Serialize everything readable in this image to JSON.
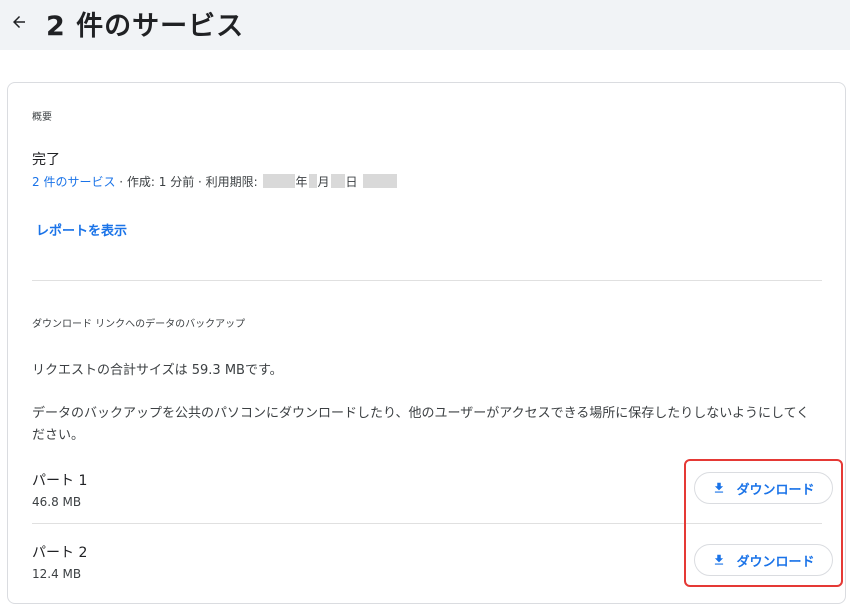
{
  "header": {
    "title": "2 件のサービス",
    "back_icon": "arrow-left-icon"
  },
  "summary": {
    "section_label": "概要",
    "status": "完了",
    "services_link": "2 件のサービス",
    "created_text": " · 作成: 1 分前 · 利用期限: ",
    "date_year": "年",
    "date_month": "月",
    "date_day": "日",
    "report_link": "レポートを表示"
  },
  "download_section": {
    "section_label": "ダウンロード リンクへのデータのバックアップ",
    "total_size_text": "リクエストの合計サイズは 59.3 MBです。",
    "warning_text": "データのバックアップを公共のパソコンにダウンロードしたり、他のユーザーがアクセスできる場所に保存したりしないようにしてください。",
    "parts": [
      {
        "name": "パート 1",
        "size": "46.8 MB",
        "button_label": "ダウンロード",
        "icon": "download-icon"
      },
      {
        "name": "パート 2",
        "size": "12.4 MB",
        "button_label": "ダウンロード",
        "icon": "download-icon"
      }
    ]
  },
  "colors": {
    "accent": "#1a73e8",
    "header_bg": "#f1f3f6",
    "highlight": "#e53935"
  }
}
